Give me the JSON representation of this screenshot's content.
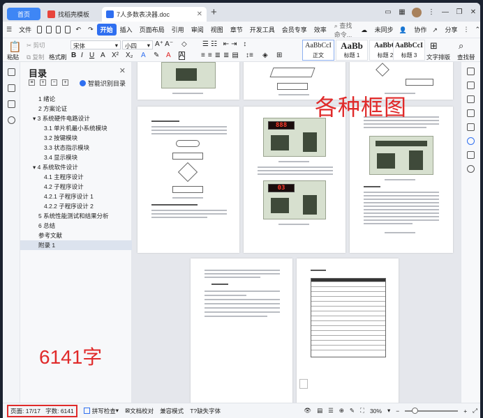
{
  "tabs": {
    "home": "首页",
    "template": "找稻壳模板",
    "document": "7人多数表决器.doc",
    "new_tab": "+"
  },
  "menu": {
    "file": "文件",
    "items": [
      "开始",
      "插入",
      "页面布局",
      "引用",
      "审阅",
      "视图",
      "章节",
      "开发工具",
      "会员专享",
      "效率"
    ],
    "search": "查找命令...",
    "unsynced": "未同步",
    "collaborate": "协作",
    "share": "分享"
  },
  "ribbon": {
    "cut": "剪切",
    "paste": "粘贴",
    "copy": "复制",
    "format_painter": "格式刷",
    "font_name": "宋体",
    "font_size": "小四",
    "styles": [
      {
        "sample": "AaBbCcI",
        "caption": "正文"
      },
      {
        "sample": "AaBb",
        "caption": "标题 1"
      },
      {
        "sample": "AaBbC",
        "caption": "标题 2"
      },
      {
        "sample": "AaBbCcI",
        "caption": "标题 3"
      }
    ],
    "text_layout": "文字排版",
    "find_replace": "查找替"
  },
  "nav": {
    "title": "目录",
    "smart_toc": "智能识别目录",
    "items": [
      {
        "label": "1 绪论",
        "level": 1
      },
      {
        "label": "2 方案论证",
        "level": 1
      },
      {
        "label": "▾ 3 系统硬件电路设计",
        "level": 0
      },
      {
        "label": "3.1 单片机最小系统模块",
        "level": 2
      },
      {
        "label": "3.2 按键模块",
        "level": 2
      },
      {
        "label": "3.3 状态指示模块",
        "level": 2
      },
      {
        "label": "3.4 显示模块",
        "level": 2
      },
      {
        "label": "▾ 4 系统软件设计",
        "level": 0
      },
      {
        "label": "4.1 主程序设计",
        "level": 2
      },
      {
        "label": "4.2 子程序设计",
        "level": 2
      },
      {
        "label": "4.2.1 子程序设计 1",
        "level": 2
      },
      {
        "label": "4.2.2 子程序设计 2",
        "level": 2
      },
      {
        "label": "5 系统性能测试和结果分析",
        "level": 1
      },
      {
        "label": "6 总结",
        "level": 1
      },
      {
        "label": "参考文献",
        "level": 1
      },
      {
        "label": "附录 1",
        "level": 1,
        "selected": true
      }
    ]
  },
  "annotations": {
    "frames": "各种框图",
    "word_count": "6141字"
  },
  "pages": {
    "p1_heading": "4.2.2 子程序设计 2",
    "p1_section": "5 系统性能测试和结果分析",
    "p3_section": "6 总结",
    "p4_section": "参考文献",
    "p5_title": "附录 1",
    "display_1": "888",
    "display_2": "03"
  },
  "status": {
    "page": "页面: 17/17",
    "words": "字数: 6141",
    "spell": "拼写检查",
    "proof": "文档校对",
    "compat": "兼容模式",
    "missing_font": "缺失字体",
    "zoom": "30%"
  }
}
